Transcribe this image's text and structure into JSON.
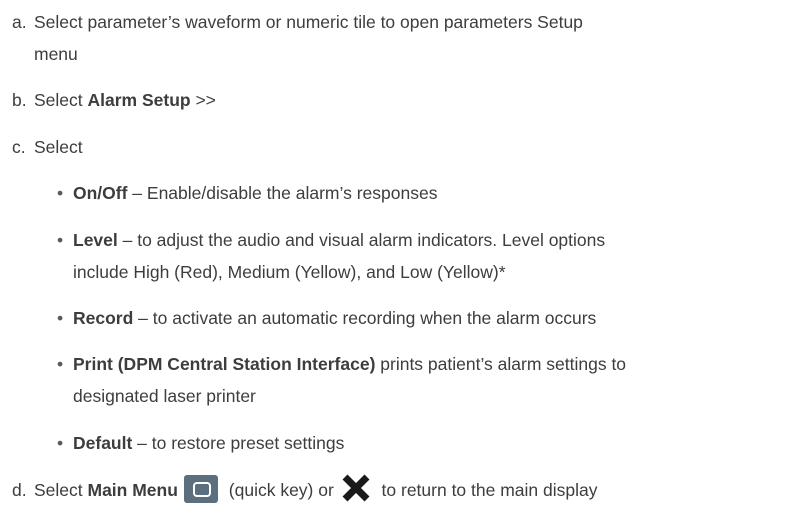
{
  "steps": {
    "a": {
      "marker": "a.",
      "text_line1": "Select parameter’s waveform or numeric tile to open parameters Setup",
      "text_line2": "menu"
    },
    "b": {
      "marker": "b.",
      "prefix": "Select ",
      "bold": "Alarm Setup",
      "suffix": " >>"
    },
    "c": {
      "marker": "c.",
      "text": "Select"
    },
    "d": {
      "marker": "d.",
      "prefix": "Select ",
      "bold": "Main Menu",
      "middle": " (quick key) or ",
      "suffix": " to return to the main display"
    }
  },
  "bullets": [
    {
      "bold": "On/Off",
      "text_line1": " – Enable/disable the alarm’s responses",
      "text_line2": ""
    },
    {
      "bold": "Level",
      "text_line1": " – to adjust the audio and visual alarm indicators. Level options",
      "text_line2": "include High (Red), Medium (Yellow), and Low (Yellow)*"
    },
    {
      "bold": "Record",
      "text_line1": " – to activate an automatic recording when the alarm occurs",
      "text_line2": ""
    },
    {
      "bold": "Print (DPM Central Station Interface)",
      "text_line1": " prints patient’s alarm settings to",
      "text_line2": "designated laser printer"
    },
    {
      "bold": "Default",
      "text_line1": " – to restore preset settings",
      "text_line2": ""
    }
  ],
  "bullet_glyph": "•",
  "icons": {
    "main_menu_key": "main-menu-quick-key-icon",
    "close": "close-x-icon"
  },
  "colors": {
    "text": "#3d3d3d",
    "menu_key_bg": "#5b6f7e",
    "close_x": "#1a1a1a"
  }
}
